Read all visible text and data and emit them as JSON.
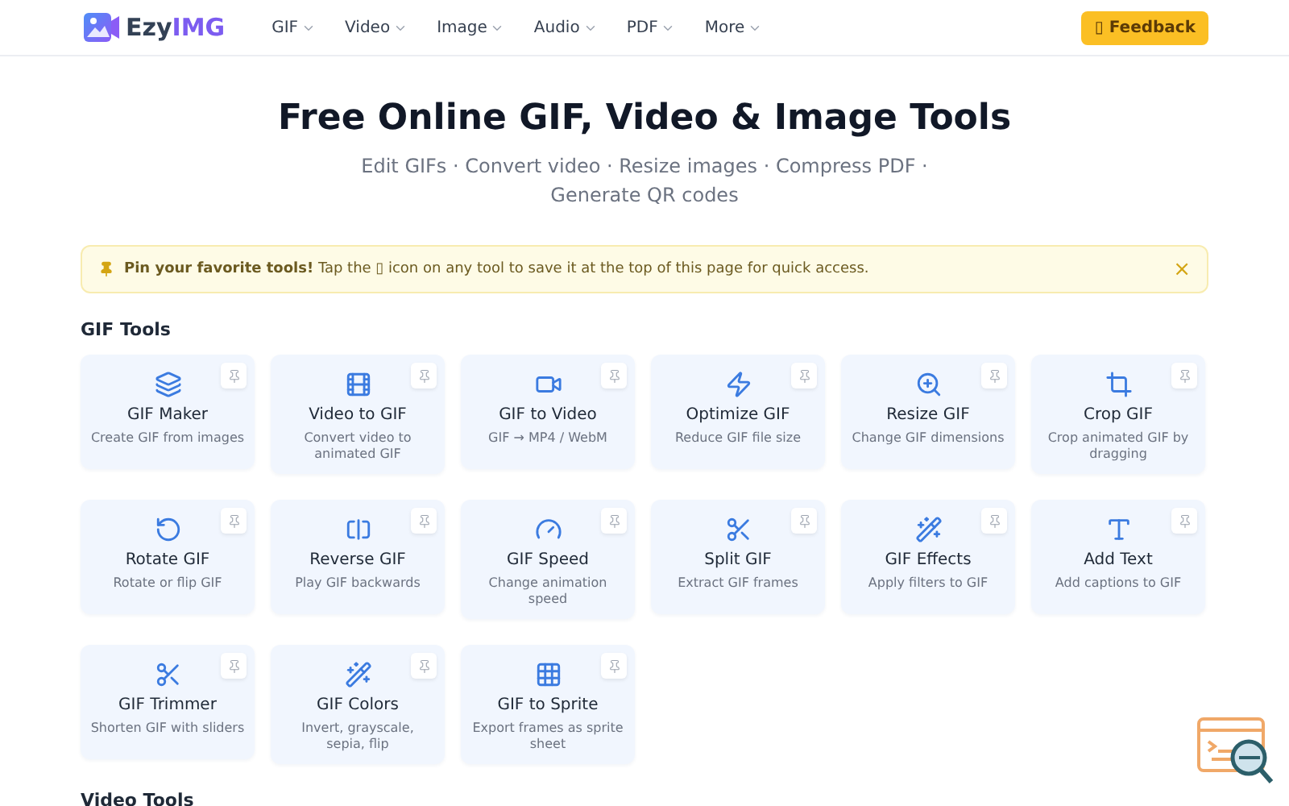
{
  "header": {
    "logo": {
      "part1": "Ezy",
      "part2": "IMG"
    },
    "nav": [
      {
        "label": "GIF"
      },
      {
        "label": "Video"
      },
      {
        "label": "Image"
      },
      {
        "label": "Audio"
      },
      {
        "label": "PDF"
      },
      {
        "label": "More"
      }
    ],
    "feedback": "▯ Feedback"
  },
  "hero": {
    "title": "Free Online GIF, Video & Image Tools",
    "subtitle": "Edit GIFs · Convert video · Resize images · Compress PDF · Generate QR codes"
  },
  "banner": {
    "text": "**Pin your favorite tools!** Tap the ▯ icon on any tool to save it at the top of this page for quick access.",
    "close": "×"
  },
  "sections": [
    {
      "title": "GIF Tools",
      "tools": [
        {
          "name": "GIF Maker",
          "description": "Create GIF from images"
        },
        {
          "name": "Video to GIF",
          "description": "Convert video to animated GIF"
        },
        {
          "name": "GIF to Video",
          "description": "GIF → MP4 / WebM"
        },
        {
          "name": "Optimize GIF",
          "description": "Reduce GIF file size"
        },
        {
          "name": "Resize GIF",
          "description": "Change GIF dimensions"
        },
        {
          "name": "Crop GIF",
          "description": "Crop animated GIF by dragging"
        },
        {
          "name": "Rotate GIF",
          "description": "Rotate or flip GIF"
        },
        {
          "name": "Reverse GIF",
          "description": "Play GIF backwards"
        },
        {
          "name": "GIF Speed",
          "description": "Change animation speed"
        },
        {
          "name": "Split GIF",
          "description": "Extract GIF frames"
        },
        {
          "name": "GIF Effects",
          "description": "Apply filters to GIF"
        },
        {
          "name": "Add Text",
          "description": "Add captions to GIF"
        },
        {
          "name": "GIF Trimmer",
          "description": "Shorten GIF with sliders"
        },
        {
          "name": "GIF Colors",
          "description": "Invert, grayscale, sepia, flip"
        },
        {
          "name": "GIF to Sprite",
          "description": "Export frames as sprite sheet"
        }
      ]
    },
    {
      "title": "Video Tools"
    }
  ]
}
